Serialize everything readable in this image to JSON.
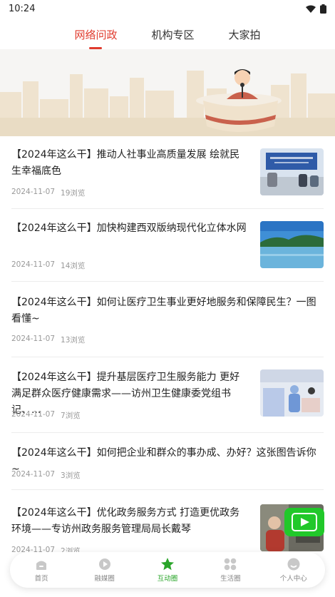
{
  "status": {
    "time": "10:24"
  },
  "tabs": [
    {
      "label": "网络问政",
      "active": true
    },
    {
      "label": "机构专区",
      "active": false
    },
    {
      "label": "大家拍",
      "active": false
    }
  ],
  "news": [
    {
      "title": "【2024年这么干】推动人社事业高质量发展 绘就民生幸福底色",
      "date": "2024-11-07",
      "views": "19浏览",
      "thumb": "office"
    },
    {
      "title": "【2024年这么干】加快构建西双版纳现代化立体水网",
      "date": "2024-11-07",
      "views": "14浏览",
      "thumb": "lake"
    },
    {
      "title": "【2024年这么干】如何让医疗卫生事业更好地服务和保障民生？一图看懂~",
      "date": "2024-11-07",
      "views": "13浏览",
      "thumb": null
    },
    {
      "title": "【2024年这么干】提升基层医疗卫生服务能力 更好满足群众医疗健康需求——访州卫生健康委党组书记、...",
      "date": "2024-11-07",
      "views": "7浏览",
      "thumb": "hospital"
    },
    {
      "title": "【2024年这么干】如何把企业和群众的事办成、办好？这张图告诉你~",
      "date": "2024-11-07",
      "views": "3浏览",
      "thumb": null
    },
    {
      "title": "【2024年这么干】优化政务服务方式 打造更优政务环境——专访州政务服务管理局局长戴琴",
      "date": "2024-11-07",
      "views": "2浏览",
      "thumb": "portrait"
    }
  ],
  "bottom_nav": [
    {
      "label": "首页",
      "icon": "home-icon",
      "active": false
    },
    {
      "label": "融媒圈",
      "icon": "play-circle-icon",
      "active": false
    },
    {
      "label": "互动圈",
      "icon": "star-icon",
      "active": true
    },
    {
      "label": "生活圈",
      "icon": "grid-icon",
      "active": false
    },
    {
      "label": "个人中心",
      "icon": "user-icon",
      "active": false
    }
  ],
  "colors": {
    "accent": "#e03b2e",
    "nav_active": "#2aa52a",
    "float_button": "#21c82a"
  }
}
